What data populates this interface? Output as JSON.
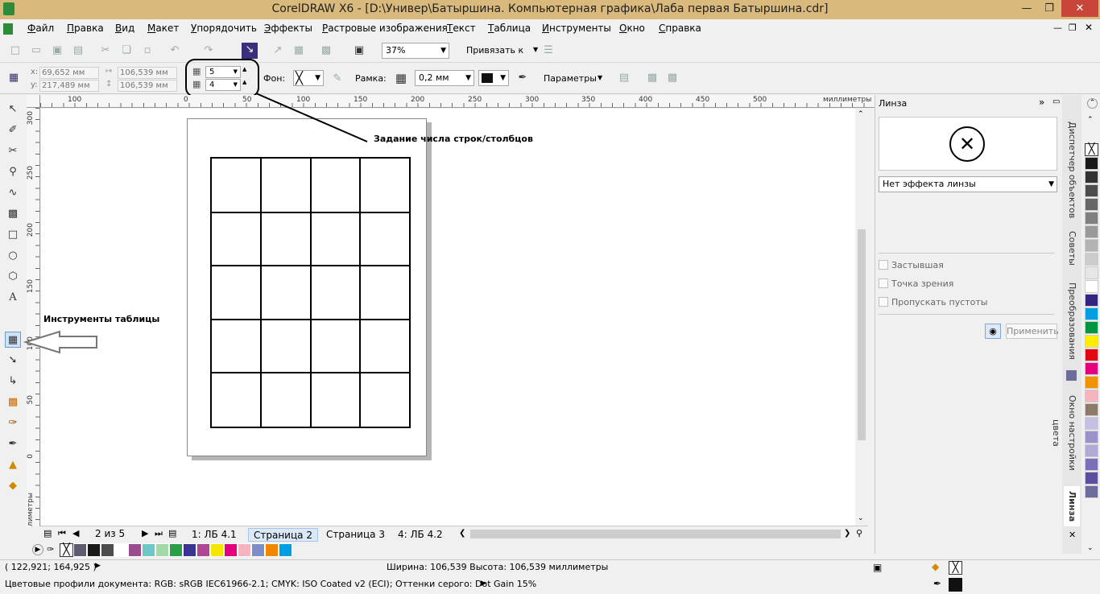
{
  "window": {
    "title": "CorelDRAW X6 - [D:\\Универ\\Батыршина. Компьютерная графика\\Лаба первая Батыршина.cdr]"
  },
  "menu": [
    "Файл",
    "Правка",
    "Вид",
    "Макет",
    "Упорядочить",
    "Эффекты",
    "Растровые изображения",
    "Текст",
    "Таблица",
    "Инструменты",
    "Окно",
    "Справка"
  ],
  "toolbar": {
    "zoom": "37%",
    "snap": "Привязать к"
  },
  "properties": {
    "x": "69,652 мм",
    "y": "217,489 мм",
    "width": "106,539 мм",
    "height": "106,539 мм",
    "rows": "5",
    "cols": "4",
    "bg_label": "Фон:",
    "border_label": "Рамка:",
    "border_width": "0,2 мм",
    "params": "Параметры"
  },
  "annotations": {
    "rowcol": "Задание числа строк/столбцов",
    "table_tools": "Инструменты таблицы"
  },
  "ruler": {
    "h_ticks": [
      "100",
      "0",
      "50",
      "100",
      "150",
      "200",
      "250",
      "300",
      "350",
      "400",
      "450",
      "500"
    ],
    "h_unit": "миллиметры",
    "v_ticks": [
      "300",
      "250",
      "200",
      "150",
      "100",
      "50",
      "0"
    ],
    "v_unit": "миллиметры"
  },
  "page_nav": {
    "counter": "2 из 5",
    "tabs": [
      "1: ЛБ 4.1",
      "Страница 2",
      "Страница 3",
      "4: ЛБ 4.2"
    ]
  },
  "table": {
    "rows": 5,
    "cols": 4
  },
  "docker": {
    "title": "Линза",
    "effect": "Нет эффекта линзы",
    "checks": [
      "Застывшая",
      "Точка зрения",
      "Пропускать пустоты"
    ],
    "apply": "Применить"
  },
  "vtabs": [
    "Диспетчер объектов",
    "Советы",
    "Преобразования",
    "Окно настройки цвета",
    "Линза"
  ],
  "status": {
    "coords": "( 122,921; 164,925 )",
    "size": "Ширина: 106,539 Высота: 106,539 миллиметры",
    "profiles": "Цветовые профили документа: RGB: sRGB IEC61966-2.1; CMYK: ISO Coated v2 (ECI); Оттенки серого: Dot Gain 15%"
  },
  "palette_bottom": [
    "#1a1a1a",
    "#4d4d4d",
    "#ffffff",
    "#9b4c8e",
    "#6cc9c6",
    "#a3d8a8",
    "#2b9e48",
    "#3a3593",
    "#b14794",
    "#f5e600",
    "#e3007d",
    "#f6b3c0",
    "#7d8ec7",
    "#f18700",
    "#009fe3"
  ],
  "palette_right": [
    "#ffffff",
    "#1a1a1a",
    "#333333",
    "#4d4d4d",
    "#666666",
    "#808080",
    "#999999",
    "#b3b3b3",
    "#cccccc",
    "#e6e6e6",
    "#ffffff",
    "#312783",
    "#009fe3",
    "#009640",
    "#ffed00",
    "#e30613",
    "#e6007e",
    "#f39200",
    "#f6b3c0",
    "#8c7b6b",
    "#c4c0e3",
    "#9c92c9",
    "#b1a9d6",
    "#7b6fb7",
    "#5c4f9e",
    "#6d6d9c"
  ]
}
